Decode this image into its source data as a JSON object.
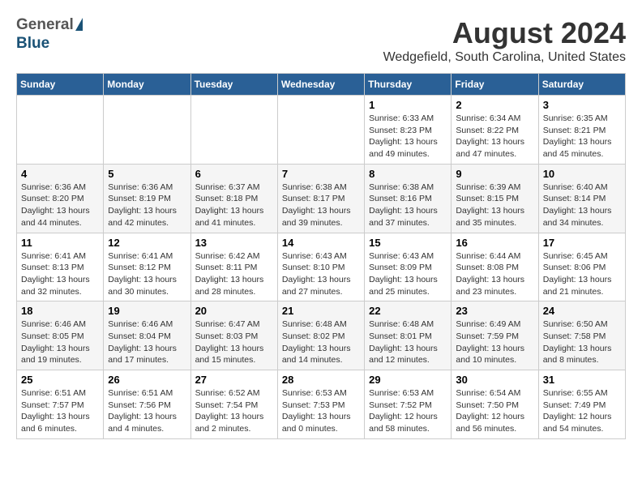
{
  "header": {
    "logo_general": "General",
    "logo_blue": "Blue",
    "title": "August 2024",
    "subtitle": "Wedgefield, South Carolina, United States"
  },
  "days_of_week": [
    "Sunday",
    "Monday",
    "Tuesday",
    "Wednesday",
    "Thursday",
    "Friday",
    "Saturday"
  ],
  "weeks": [
    [
      {
        "day": "",
        "info": ""
      },
      {
        "day": "",
        "info": ""
      },
      {
        "day": "",
        "info": ""
      },
      {
        "day": "",
        "info": ""
      },
      {
        "day": "1",
        "info": "Sunrise: 6:33 AM\nSunset: 8:23 PM\nDaylight: 13 hours\nand 49 minutes."
      },
      {
        "day": "2",
        "info": "Sunrise: 6:34 AM\nSunset: 8:22 PM\nDaylight: 13 hours\nand 47 minutes."
      },
      {
        "day": "3",
        "info": "Sunrise: 6:35 AM\nSunset: 8:21 PM\nDaylight: 13 hours\nand 45 minutes."
      }
    ],
    [
      {
        "day": "4",
        "info": "Sunrise: 6:36 AM\nSunset: 8:20 PM\nDaylight: 13 hours\nand 44 minutes."
      },
      {
        "day": "5",
        "info": "Sunrise: 6:36 AM\nSunset: 8:19 PM\nDaylight: 13 hours\nand 42 minutes."
      },
      {
        "day": "6",
        "info": "Sunrise: 6:37 AM\nSunset: 8:18 PM\nDaylight: 13 hours\nand 41 minutes."
      },
      {
        "day": "7",
        "info": "Sunrise: 6:38 AM\nSunset: 8:17 PM\nDaylight: 13 hours\nand 39 minutes."
      },
      {
        "day": "8",
        "info": "Sunrise: 6:38 AM\nSunset: 8:16 PM\nDaylight: 13 hours\nand 37 minutes."
      },
      {
        "day": "9",
        "info": "Sunrise: 6:39 AM\nSunset: 8:15 PM\nDaylight: 13 hours\nand 35 minutes."
      },
      {
        "day": "10",
        "info": "Sunrise: 6:40 AM\nSunset: 8:14 PM\nDaylight: 13 hours\nand 34 minutes."
      }
    ],
    [
      {
        "day": "11",
        "info": "Sunrise: 6:41 AM\nSunset: 8:13 PM\nDaylight: 13 hours\nand 32 minutes."
      },
      {
        "day": "12",
        "info": "Sunrise: 6:41 AM\nSunset: 8:12 PM\nDaylight: 13 hours\nand 30 minutes."
      },
      {
        "day": "13",
        "info": "Sunrise: 6:42 AM\nSunset: 8:11 PM\nDaylight: 13 hours\nand 28 minutes."
      },
      {
        "day": "14",
        "info": "Sunrise: 6:43 AM\nSunset: 8:10 PM\nDaylight: 13 hours\nand 27 minutes."
      },
      {
        "day": "15",
        "info": "Sunrise: 6:43 AM\nSunset: 8:09 PM\nDaylight: 13 hours\nand 25 minutes."
      },
      {
        "day": "16",
        "info": "Sunrise: 6:44 AM\nSunset: 8:08 PM\nDaylight: 13 hours\nand 23 minutes."
      },
      {
        "day": "17",
        "info": "Sunrise: 6:45 AM\nSunset: 8:06 PM\nDaylight: 13 hours\nand 21 minutes."
      }
    ],
    [
      {
        "day": "18",
        "info": "Sunrise: 6:46 AM\nSunset: 8:05 PM\nDaylight: 13 hours\nand 19 minutes."
      },
      {
        "day": "19",
        "info": "Sunrise: 6:46 AM\nSunset: 8:04 PM\nDaylight: 13 hours\nand 17 minutes."
      },
      {
        "day": "20",
        "info": "Sunrise: 6:47 AM\nSunset: 8:03 PM\nDaylight: 13 hours\nand 15 minutes."
      },
      {
        "day": "21",
        "info": "Sunrise: 6:48 AM\nSunset: 8:02 PM\nDaylight: 13 hours\nand 14 minutes."
      },
      {
        "day": "22",
        "info": "Sunrise: 6:48 AM\nSunset: 8:01 PM\nDaylight: 13 hours\nand 12 minutes."
      },
      {
        "day": "23",
        "info": "Sunrise: 6:49 AM\nSunset: 7:59 PM\nDaylight: 13 hours\nand 10 minutes."
      },
      {
        "day": "24",
        "info": "Sunrise: 6:50 AM\nSunset: 7:58 PM\nDaylight: 13 hours\nand 8 minutes."
      }
    ],
    [
      {
        "day": "25",
        "info": "Sunrise: 6:51 AM\nSunset: 7:57 PM\nDaylight: 13 hours\nand 6 minutes."
      },
      {
        "day": "26",
        "info": "Sunrise: 6:51 AM\nSunset: 7:56 PM\nDaylight: 13 hours\nand 4 minutes."
      },
      {
        "day": "27",
        "info": "Sunrise: 6:52 AM\nSunset: 7:54 PM\nDaylight: 13 hours\nand 2 minutes."
      },
      {
        "day": "28",
        "info": "Sunrise: 6:53 AM\nSunset: 7:53 PM\nDaylight: 13 hours\nand 0 minutes."
      },
      {
        "day": "29",
        "info": "Sunrise: 6:53 AM\nSunset: 7:52 PM\nDaylight: 12 hours\nand 58 minutes."
      },
      {
        "day": "30",
        "info": "Sunrise: 6:54 AM\nSunset: 7:50 PM\nDaylight: 12 hours\nand 56 minutes."
      },
      {
        "day": "31",
        "info": "Sunrise: 6:55 AM\nSunset: 7:49 PM\nDaylight: 12 hours\nand 54 minutes."
      }
    ]
  ]
}
